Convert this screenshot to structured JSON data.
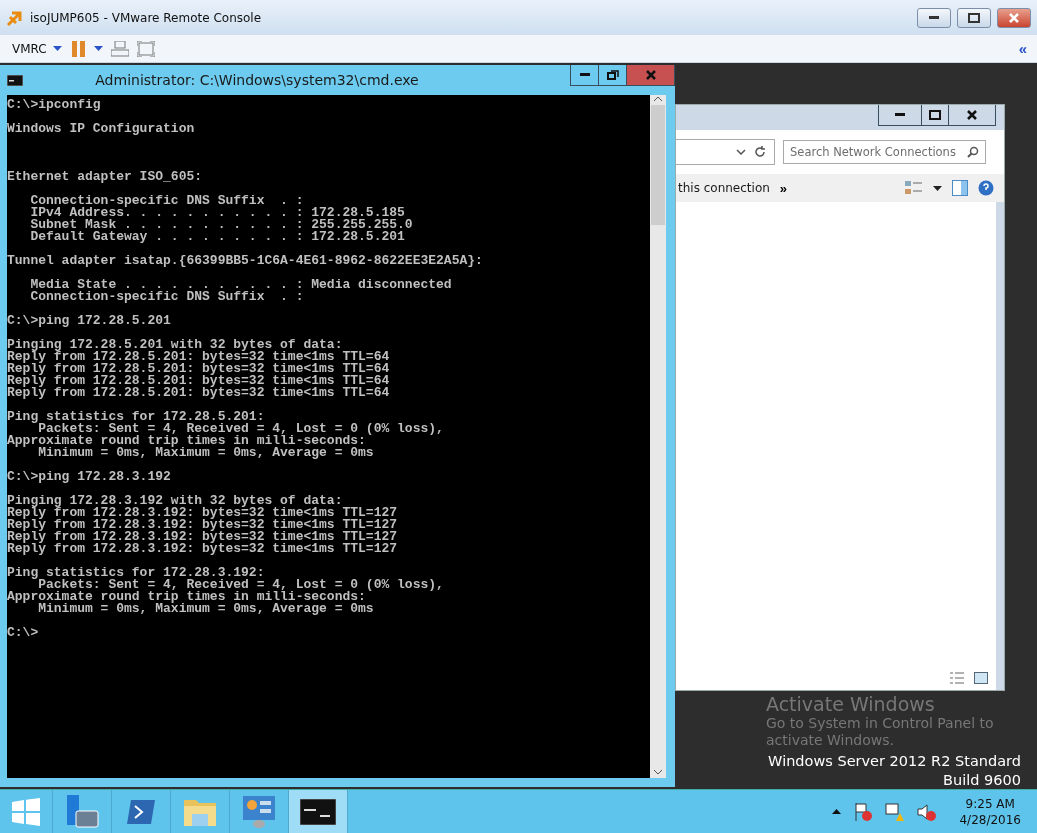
{
  "window": {
    "title": "isoJUMP605 - VMware Remote Console"
  },
  "toolbar": {
    "menu_label": "VMRC",
    "collapse_glyph": "«"
  },
  "cmd_window": {
    "title": "Administrator: C:\\Windows\\system32\\cmd.exe",
    "blocks": [
      {
        "kind": "paragraph",
        "lines": [
          "C:\\>ipconfig"
        ]
      },
      {
        "kind": "paragraph",
        "lines": [
          "Windows IP Configuration"
        ]
      },
      {
        "kind": "section",
        "lines": [
          "Ethernet adapter ISO_605:"
        ]
      },
      {
        "kind": "paragraph",
        "lines": [
          "   Connection-specific DNS Suffix  . :",
          "   IPv4 Address. . . . . . . . . . . : 172.28.5.185",
          "   Subnet Mask . . . . . . . . . . . : 255.255.255.0",
          "   Default Gateway . . . . . . . . . : 172.28.5.201"
        ]
      },
      {
        "kind": "paragraph",
        "lines": [
          "Tunnel adapter isatap.{66399BB5-1C6A-4E61-8962-8622EE3E2A5A}:"
        ]
      },
      {
        "kind": "paragraph",
        "lines": [
          "   Media State . . . . . . . . . . . : Media disconnected",
          "   Connection-specific DNS Suffix  . :"
        ]
      },
      {
        "kind": "paragraph",
        "lines": [
          "C:\\>ping 172.28.5.201"
        ]
      },
      {
        "kind": "paragraph",
        "lines": [
          "Pinging 172.28.5.201 with 32 bytes of data:",
          "Reply from 172.28.5.201: bytes=32 time<1ms TTL=64",
          "Reply from 172.28.5.201: bytes=32 time<1ms TTL=64",
          "Reply from 172.28.5.201: bytes=32 time<1ms TTL=64",
          "Reply from 172.28.5.201: bytes=32 time<1ms TTL=64"
        ]
      },
      {
        "kind": "paragraph",
        "lines": [
          "Ping statistics for 172.28.5.201:",
          "    Packets: Sent = 4, Received = 4, Lost = 0 (0% loss),",
          "Approximate round trip times in milli-seconds:",
          "    Minimum = 0ms, Maximum = 0ms, Average = 0ms"
        ]
      },
      {
        "kind": "paragraph",
        "lines": [
          "C:\\>ping 172.28.3.192"
        ]
      },
      {
        "kind": "paragraph",
        "lines": [
          "Pinging 172.28.3.192 with 32 bytes of data:",
          "Reply from 172.28.3.192: bytes=32 time<1ms TTL=127",
          "Reply from 172.28.3.192: bytes=32 time<1ms TTL=127",
          "Reply from 172.28.3.192: bytes=32 time<1ms TTL=127",
          "Reply from 172.28.3.192: bytes=32 time<1ms TTL=127"
        ]
      },
      {
        "kind": "paragraph",
        "lines": [
          "Ping statistics for 172.28.3.192:",
          "    Packets: Sent = 4, Received = 4, Lost = 0 (0% loss),",
          "Approximate round trip times in milli-seconds:",
          "    Minimum = 0ms, Maximum = 0ms, Average = 0ms"
        ]
      },
      {
        "kind": "paragraph",
        "lines": [
          "C:\\>"
        ]
      }
    ]
  },
  "explorer_window": {
    "search_placeholder": "Search Network Connections",
    "toolbar_text": "this connection",
    "more_glyph": "»"
  },
  "watermark": {
    "title": "Activate Windows",
    "lines": [
      "Go to System in Control Panel to",
      "activate Windows."
    ]
  },
  "desktop_info": [
    "Windows Server 2012 R2 Standard",
    "Build 9600"
  ],
  "taskbar": {
    "apps": [
      {
        "kind": "server-manager",
        "selected": false
      },
      {
        "kind": "powershell",
        "selected": false
      },
      {
        "kind": "explorer",
        "selected": false
      },
      {
        "kind": "control-panel",
        "selected": false
      },
      {
        "kind": "cmd",
        "selected": true
      }
    ],
    "time": "9:25 AM",
    "date": "4/28/2016"
  }
}
